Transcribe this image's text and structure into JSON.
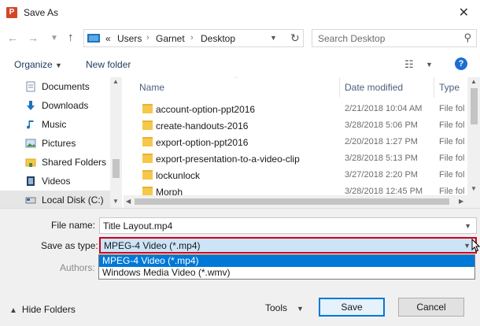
{
  "window": {
    "title": "Save As",
    "app_icon": "P"
  },
  "address": {
    "overflow": "«",
    "crumbs": [
      "Users",
      "Garnet",
      "Desktop"
    ],
    "search_placeholder": "Search Desktop"
  },
  "toolbar": {
    "organize": "Organize",
    "new_folder": "New folder"
  },
  "nav_pane": {
    "items": [
      {
        "label": "Documents",
        "icon": "documents-icon"
      },
      {
        "label": "Downloads",
        "icon": "downloads-icon"
      },
      {
        "label": "Music",
        "icon": "music-icon"
      },
      {
        "label": "Pictures",
        "icon": "pictures-icon"
      },
      {
        "label": "Shared Folders",
        "icon": "shared-folders-icon"
      },
      {
        "label": "Videos",
        "icon": "videos-icon"
      },
      {
        "label": "Local Disk (C:)",
        "icon": "local-disk-icon",
        "selected": true
      }
    ]
  },
  "file_list": {
    "columns": [
      "Name",
      "Date modified",
      "Type"
    ],
    "rows": [
      {
        "name": "account-option-ppt2016",
        "date": "2/21/2018 10:04 AM",
        "type": "File fol"
      },
      {
        "name": "create-handouts-2016",
        "date": "3/28/2018 5:06 PM",
        "type": "File fol"
      },
      {
        "name": "export-option-ppt2016",
        "date": "2/20/2018 1:27 PM",
        "type": "File fol"
      },
      {
        "name": "export-presentation-to-a-video-clip",
        "date": "3/28/2018 5:13 PM",
        "type": "File fol"
      },
      {
        "name": "lockunlock",
        "date": "3/27/2018 2:20 PM",
        "type": "File fol"
      },
      {
        "name": "Morph",
        "date": "3/28/2018 12:45 PM",
        "type": "File fol"
      }
    ]
  },
  "form": {
    "file_name_label": "File name:",
    "file_name_value": "Title Layout.mp4",
    "save_as_type_label": "Save as type:",
    "save_as_type_value": "MPEG-4 Video (*.mp4)",
    "authors_label": "Authors:",
    "type_options": [
      "MPEG-4 Video (*.mp4)",
      "Windows Media Video (*.wmv)"
    ]
  },
  "footer": {
    "hide_folders": "Hide Folders",
    "tools": "Tools",
    "save": "Save",
    "cancel": "Cancel"
  },
  "colors": {
    "accent": "#0078d7",
    "highlight_border": "#d0021b",
    "selection": "#cce4f7"
  }
}
